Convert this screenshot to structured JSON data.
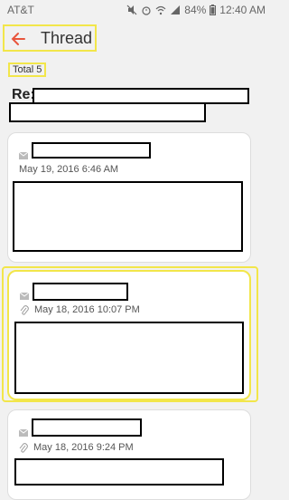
{
  "status_bar": {
    "carrier": "AT&T",
    "battery": "84%",
    "time": "12:40 AM"
  },
  "app_bar": {
    "title": "Thread",
    "back_icon": "arrow-left-icon"
  },
  "thread": {
    "total_label": "Total 5",
    "subject_prefix": "Re:"
  },
  "messages": [
    {
      "date": "May 19, 2016  6:46 AM",
      "has_attachment": false
    },
    {
      "date": "May 18, 2016  10:07 PM",
      "has_attachment": true
    },
    {
      "date": "May 18, 2016  9:24 PM",
      "has_attachment": true
    }
  ],
  "colors": {
    "accent_back_arrow": "#e8553d",
    "highlight": "#f2e64a"
  }
}
